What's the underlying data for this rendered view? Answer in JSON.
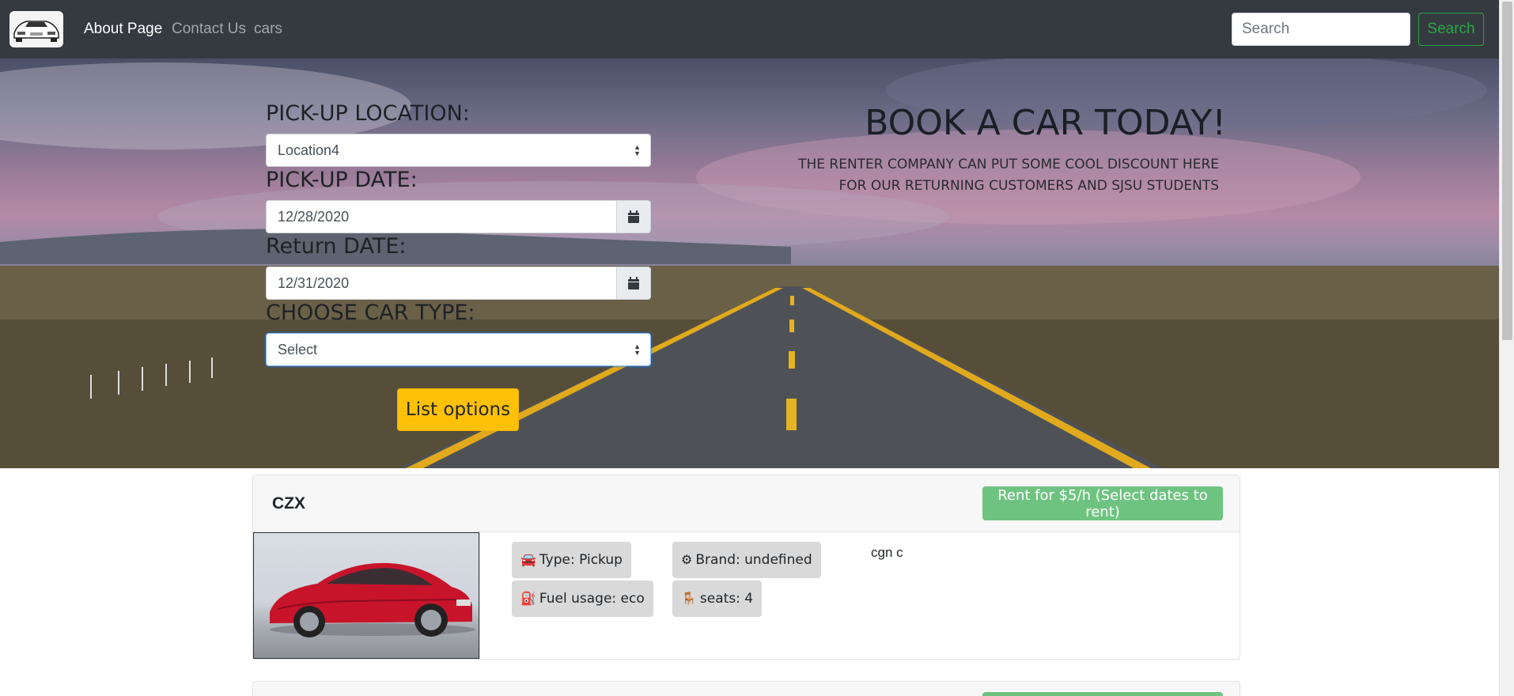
{
  "navbar": {
    "logo": "car-logo",
    "links": [
      "About Page",
      "Contact Us",
      "cars"
    ],
    "search_placeholder": "Search",
    "search_button": "Search"
  },
  "hero": {
    "pickup_location_label": "PICK-UP LOCATION:",
    "pickup_location_value": "Location4",
    "pickup_date_label": "PICK-UP DATE:",
    "pickup_date_value": "12/28/2020",
    "return_date_label": "Return DATE:",
    "return_date_value": "12/31/2020",
    "car_type_label": "CHOOSE CAR TYPE:",
    "car_type_value": "Select",
    "list_button": "List options",
    "title": "BOOK A CAR TODAY!",
    "subtitle_line1": "THE RENTER COMPANY CAN PUT SOME COOL DISCOUNT HERE",
    "subtitle_line2": "FOR OUR RETURNING CUSTOMERS AND SJSU STUDENTS"
  },
  "cars": [
    {
      "name": "CZX",
      "rent_button": "Rent for $5/h (Select dates to rent)",
      "type": "Type: Pickup",
      "brand": "Brand: undefined",
      "fuel": "Fuel usage: eco",
      "seats": "seats: 4",
      "description": "cgn c",
      "photo_color": "#c8142a"
    }
  ],
  "colors": {
    "navbar": "#343a40",
    "search_accent": "#28a745",
    "list_button": "#ffc107",
    "rent_button": "#6fc381"
  }
}
